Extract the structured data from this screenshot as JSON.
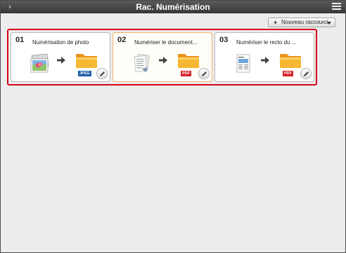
{
  "window": {
    "title": "Rac. Numérisation",
    "expand_glyph": "›"
  },
  "toolbar": {
    "new_shortcut_plus": "+",
    "new_shortcut_label": "Nouveau raccourci"
  },
  "shortcuts": [
    {
      "number": "01",
      "title": "Numérisation de photo",
      "source_icon": "photo-icon",
      "format": "JPEG",
      "selected": false
    },
    {
      "number": "02",
      "title": "Numériser le document...",
      "source_icon": "document-icon",
      "format": "PDF",
      "selected": true
    },
    {
      "number": "03",
      "title": "Numériser le recto du ...",
      "source_icon": "page-front-icon",
      "format": "PDF",
      "selected": false
    }
  ],
  "colors": {
    "titlebar": "#3f3f3f",
    "shortcut_area_border": "#d9001b",
    "jpeg_badge": "#1f5fa8",
    "pdf_badge": "#d8202a",
    "folder": "#f4a623"
  }
}
